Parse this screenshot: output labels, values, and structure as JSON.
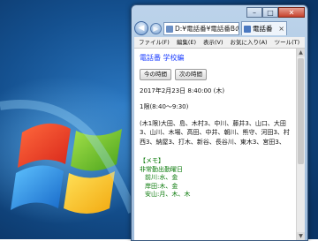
{
  "window": {
    "address": "D:¥電話番¥電話番Bのためし",
    "tab_label": "電話番",
    "controls": {
      "minimize": "–",
      "maximize": "□",
      "close": "✕"
    }
  },
  "menubar": [
    "ファイル(F)",
    "編集(E)",
    "表示(V)",
    "お気に入り(A)",
    "ツール(T)"
  ],
  "page": {
    "title": "電話番 学校編",
    "buttons": {
      "now": "今の時間",
      "next": "次の時間"
    },
    "datetime": "2017年2月23日 8:40:00 (木)",
    "period": "1限(8:40～9:30)",
    "names": "(木1限)大田、島、木村3、中川、藤井3、山口、大田3、山川、木場、高田、中井、朝川、熊守、河田3、村西3、納屋3、打木、新谷、長谷川、東木3、宮田3、",
    "memo": {
      "heading": "【メモ】",
      "subheading": "非常勤出勤曜日",
      "lines": [
        "前川:水、金",
        "岸田:木、金",
        "安山:月、木、木"
      ]
    }
  }
}
